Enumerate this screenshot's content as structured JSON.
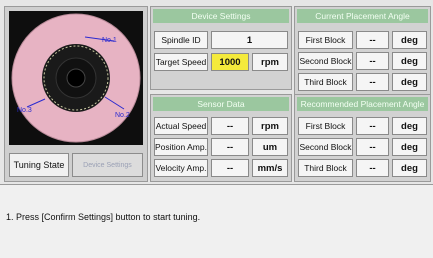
{
  "disk": {
    "label_top": "No.1",
    "label_left": "No.3",
    "label_right": "No.2"
  },
  "tuning": {
    "label": "Tuning State",
    "button": "Device Settings"
  },
  "device_settings": {
    "title": "Device Settings",
    "rows": [
      {
        "label": "Spindle ID",
        "value": "1",
        "unit": ""
      },
      {
        "label": "Target Speed",
        "value": "1000",
        "unit": "rpm"
      }
    ]
  },
  "sensor_data": {
    "title": "Sensor Data",
    "rows": [
      {
        "label": "Actual Speed",
        "value": "--",
        "unit": "rpm"
      },
      {
        "label": "Position Amp.",
        "value": "--",
        "unit": "um"
      },
      {
        "label": "Velocity Amp.",
        "value": "--",
        "unit": "mm/s"
      }
    ]
  },
  "current_angle": {
    "title": "Current Placement Angle",
    "rows": [
      {
        "label": "First Block",
        "value": "--",
        "unit": "deg"
      },
      {
        "label": "Second Block",
        "value": "--",
        "unit": "deg"
      },
      {
        "label": "Third Block",
        "value": "--",
        "unit": "deg"
      }
    ]
  },
  "recommended_angle": {
    "title": "Recommended Placement Angle",
    "rows": [
      {
        "label": "First Block",
        "value": "--",
        "unit": "deg"
      },
      {
        "label": "Second Block",
        "value": "--",
        "unit": "deg"
      },
      {
        "label": "Third Block",
        "value": "--",
        "unit": "deg"
      }
    ]
  },
  "message": "1. Press [Confirm Settings] button to start tuning.",
  "colors": {
    "panel_header": "#9bc79f",
    "highlight": "#f4ea3c",
    "disk": "#e7b3c3"
  }
}
